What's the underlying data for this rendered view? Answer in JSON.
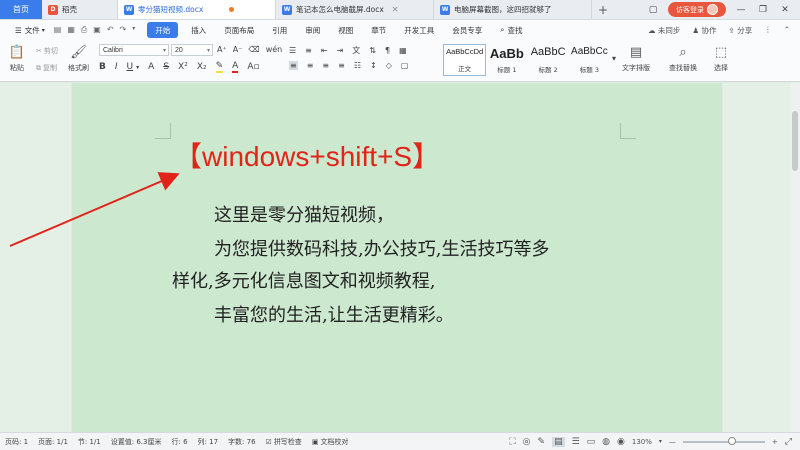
{
  "tabs": {
    "home": "首页",
    "items": [
      {
        "label": "稻壳",
        "icon": "docer-icon"
      },
      {
        "label": "零分猫短视频.docx",
        "icon": "w-doc-icon",
        "active": true
      },
      {
        "label": "笔记本怎么电脑截屏.docx",
        "icon": "w-doc-icon"
      },
      {
        "label": "电脑屏幕截图，这四招就够了",
        "icon": "w-doc-icon"
      }
    ],
    "visitor_login": "访客登录"
  },
  "menu": {
    "file": "文件",
    "items": [
      "开始",
      "插入",
      "页面布局",
      "引用",
      "审阅",
      "视图",
      "章节",
      "开发工具",
      "会员专享"
    ],
    "search": "查找",
    "right": [
      "未同步",
      "协作",
      "分享"
    ]
  },
  "ribbon": {
    "paste": "粘贴",
    "cut": "剪切",
    "copy": "复制",
    "format_painter": "格式刷",
    "font_name": "Calibri",
    "font_size": "20",
    "styles": [
      {
        "sample": "AaBbCcDd",
        "name": "正文"
      },
      {
        "sample": "AaBb",
        "name": "标题 1"
      },
      {
        "sample": "AaBbC",
        "name": "标题 2"
      },
      {
        "sample": "AaBbCc",
        "name": "标题 3"
      }
    ],
    "text_layout": "文字排版",
    "find_replace": "查找替换",
    "select": "选择"
  },
  "document": {
    "heading": "【windows+shift+S】",
    "lines": [
      "这里是零分猫短视频，",
      "为您提供数码科技,办公技巧,生活技巧等多",
      "样化,多元化信息图文和视频教程,",
      "丰富您的生活,让生活更精彩。"
    ]
  },
  "status": {
    "page_num": "页码: 1",
    "page_count": "页面: 1/1",
    "section": "节: 1/1",
    "setting": "设置值: 6.3厘米",
    "row": "行: 6",
    "col": "列: 17",
    "word_count": "字数: 76",
    "spell_check": "拼写检查",
    "doc_proof": "文档校对",
    "zoom": "130%"
  },
  "colors": {
    "accent": "#3a7ce9",
    "heading_red": "#e02418",
    "page_green": "#cce8cf",
    "visitor_btn": "#e8573c"
  }
}
